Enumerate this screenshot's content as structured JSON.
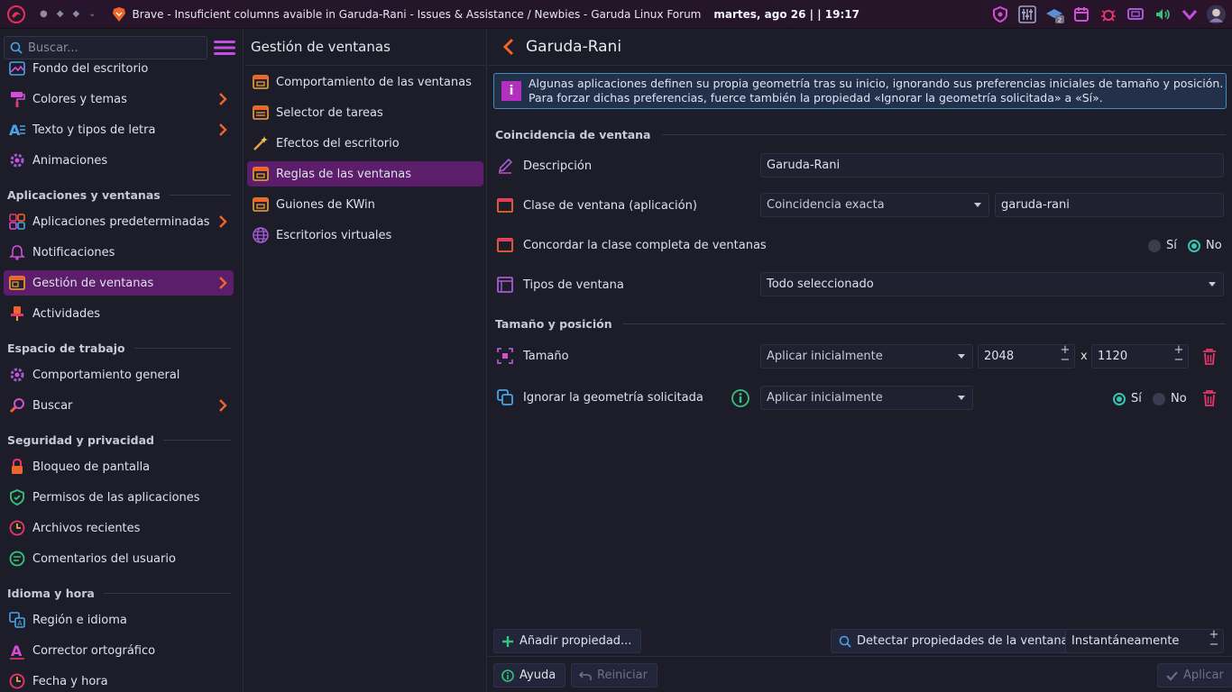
{
  "panel": {
    "window_title": "Brave - Insuficient columns avaible in Garuda-Rani - Issues & Assistance / Newbies - Garuda Linux Forum",
    "clock": "martes, ago 26 | | 19:17",
    "tray_badge": "2"
  },
  "sidebar": {
    "search_placeholder": "Buscar...",
    "items": [
      {
        "label": "Fondo del escritorio"
      },
      {
        "label": "Colores y temas"
      },
      {
        "label": "Texto y tipos de letra"
      },
      {
        "label": "Animaciones"
      },
      {
        "label": "Aplicaciones predeterminadas"
      },
      {
        "label": "Notificaciones"
      },
      {
        "label": "Gestión de ventanas"
      },
      {
        "label": "Actividades"
      },
      {
        "label": "Comportamiento general"
      },
      {
        "label": "Buscar"
      },
      {
        "label": "Bloqueo de pantalla"
      },
      {
        "label": "Permisos de las aplicaciones"
      },
      {
        "label": "Archivos recientes"
      },
      {
        "label": "Comentarios del usuario"
      },
      {
        "label": "Región e idioma"
      },
      {
        "label": "Corrector ortográfico"
      },
      {
        "label": "Fecha y hora"
      }
    ],
    "sections": {
      "apps": "Aplicaciones y ventanas",
      "workspace": "Espacio de trabajo",
      "security": "Seguridad y privacidad",
      "language": "Idioma y hora"
    }
  },
  "middle": {
    "title": "Gestión de ventanas",
    "items": [
      {
        "label": "Comportamiento de las ventanas"
      },
      {
        "label": "Selector de tareas"
      },
      {
        "label": "Efectos del escritorio"
      },
      {
        "label": "Reglas de las ventanas"
      },
      {
        "label": "Guiones de KWin"
      },
      {
        "label": "Escritorios virtuales"
      }
    ]
  },
  "content": {
    "title": "Garuda-Rani",
    "notice": "Algunas aplicaciones definen su propia geometría tras su inicio, ignorando sus preferencias iniciales de tamaño y posición. Para forzar dichas preferencias, fuerce también la propiedad «Ignorar la geometría solicitada» a «Sí».",
    "group_match": "Coincidencia de ventana",
    "group_size": "Tamaño y posición",
    "description_label": "Descripción",
    "description_value": "Garuda-Rani",
    "class_label": "Clase de ventana (aplicación)",
    "class_match": "Coincidencia exacta",
    "class_value": "garuda-rani",
    "whole_class_label": "Concordar la clase completa de ventanas",
    "yes": "Sí",
    "no": "No",
    "types_label": "Tipos de ventana",
    "types_value": "Todo seleccionado",
    "size_label": "Tamaño",
    "size_policy": "Aplicar inicialmente",
    "width": "2048",
    "x": "x",
    "height": "1120",
    "ignore_label": "Ignorar la geometría solicitada",
    "ignore_policy": "Aplicar inicialmente",
    "add_property": "Añadir propiedad...",
    "detect": "Detectar propiedades de la ventana",
    "delay": "Instantáneamente",
    "help": "Ayuda",
    "reset": "Reiniciar",
    "apply": "Aplicar"
  },
  "colors": {
    "accent": "#5c1d6a",
    "radio_on": "#35c4b1",
    "trash": "#e8356b",
    "info_box": "#3e8fbf"
  }
}
